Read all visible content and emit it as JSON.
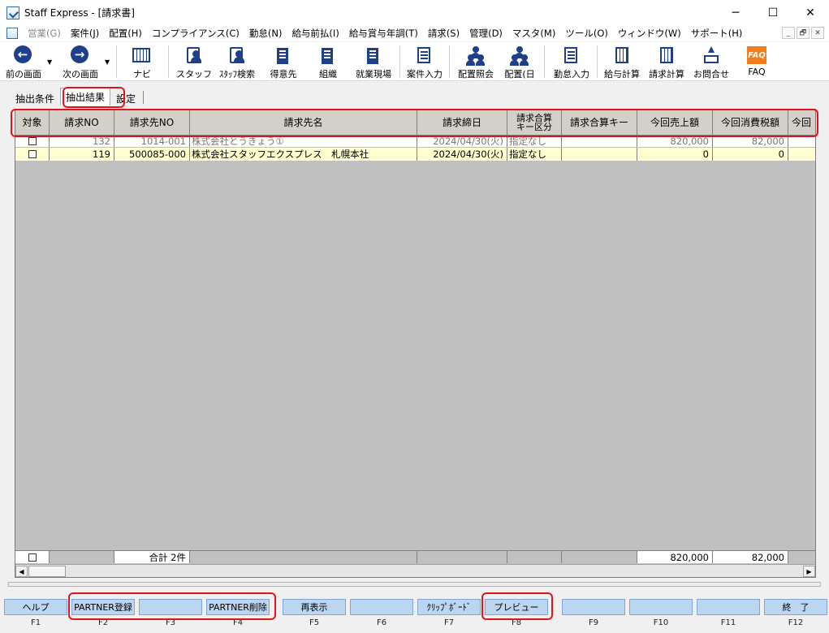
{
  "window": {
    "title": "Staff Express - [請求書]",
    "minimize": "─",
    "maximize": "☐",
    "close": "✕"
  },
  "menu": [
    "営業(G)",
    "案件(J)",
    "配置(H)",
    "コンプライアンス(C)",
    "勤怠(N)",
    "給与前払(I)",
    "給与賞与年調(T)",
    "請求(S)",
    "管理(D)",
    "マスタ(M)",
    "ツール(O)",
    "ウィンドウ(W)",
    "サポート(H)"
  ],
  "mdi": {
    "minimize": "_",
    "restore": "🗗",
    "close": "✕"
  },
  "toolbar": {
    "back": "前の画面",
    "forward": "次の画面",
    "navi": "ナビ",
    "staff": "スタッフ",
    "staff_search": "ｽﾀｯﾌ検索",
    "client": "得意先",
    "org": "組織",
    "site": "就業現場",
    "case_input": "案件入力",
    "assign_query": "配置照会",
    "assign_day": "配置(日",
    "attendance": "勤怠入力",
    "payroll": "給与計算",
    "billing": "請求計算",
    "contact": "お問合せ",
    "faq": "FAQ",
    "faq_icon": "FAQ"
  },
  "tabs": [
    "抽出条件",
    "抽出結果",
    "設定"
  ],
  "columns": [
    "対象",
    "請求NO",
    "請求先NO",
    "請求先名",
    "請求締日",
    "請求合算\nキー区分",
    "請求合算キー",
    "今回売上額",
    "今回消費税額",
    "今回"
  ],
  "rows": [
    {
      "no": "132",
      "client_no": "1014-001",
      "client_name": "株式会社とうきょう①",
      "close_date": "2024/04/30(火)",
      "key_type": "指定なし",
      "key": "",
      "sales": "820,000",
      "tax": "82,000"
    },
    {
      "no": "119",
      "client_no": "500085-000",
      "client_name": "株式会社スタッフエクスプレス　札幌本社",
      "close_date": "2024/04/30(火)",
      "key_type": "指定なし",
      "key": "",
      "sales": "0",
      "tax": "0"
    }
  ],
  "footer": {
    "total_label": "合計 2件",
    "sales_total": "820,000",
    "tax_total": "82,000"
  },
  "fkeys": [
    {
      "label": "ヘルプ",
      "key": "F1"
    },
    {
      "label": "PARTNER登録",
      "key": "F2"
    },
    {
      "label": "",
      "key": "F3"
    },
    {
      "label": "PARTNER削除",
      "key": "F4"
    },
    {
      "label": "再表示",
      "key": "F5"
    },
    {
      "label": "",
      "key": "F6"
    },
    {
      "label": "ｸﾘｯﾌﾟﾎﾞｰﾄﾞ",
      "key": "F7"
    },
    {
      "label": "プレビュー",
      "key": "F8"
    },
    {
      "label": "",
      "key": "F9"
    },
    {
      "label": "",
      "key": "F10"
    },
    {
      "label": "",
      "key": "F11"
    },
    {
      "label": "終　了",
      "key": "F12"
    }
  ],
  "colors": {
    "highlight": "#e0151b",
    "fkey_bg": "#bcd5f0",
    "row_yellow": "#ffffd0",
    "icon_blue": "#1e3f8a",
    "faq_orange": "#f07c1a"
  }
}
